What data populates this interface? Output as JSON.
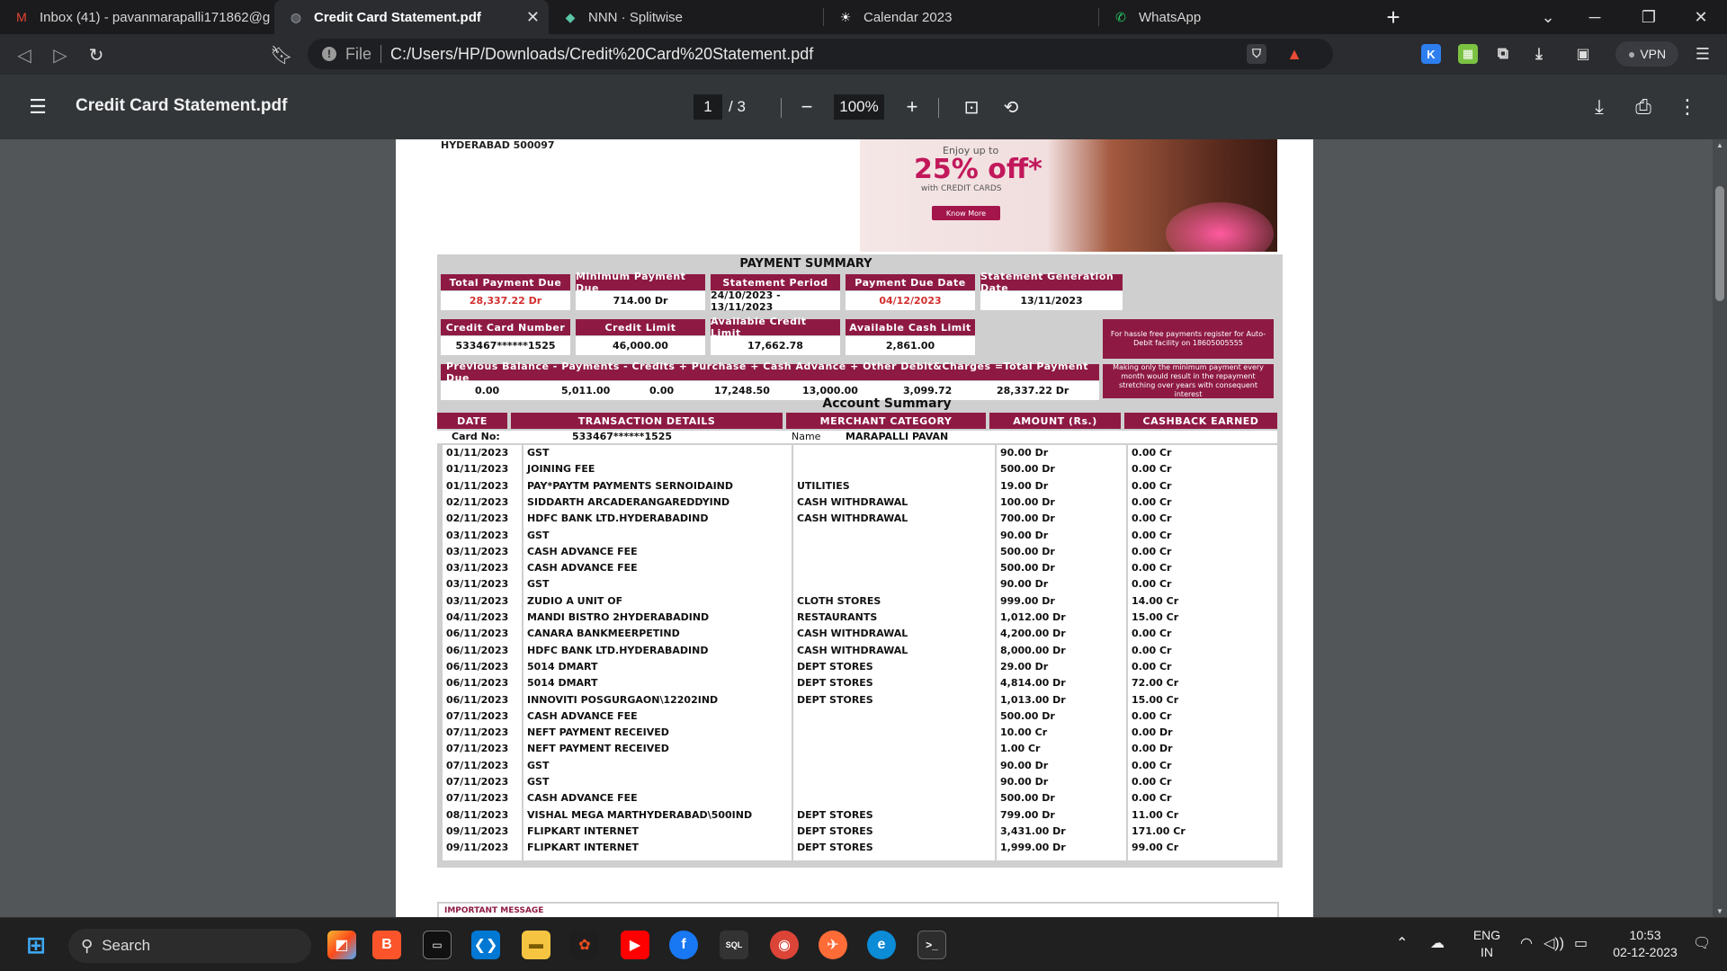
{
  "browser": {
    "tabs": [
      {
        "title": "Inbox (41) - pavanmarapalli171862@g",
        "icon": "gmail-icon",
        "color": "#ea4335",
        "glyph": "M",
        "active": false
      },
      {
        "title": "Credit Card Statement.pdf",
        "icon": "globe-icon",
        "color": "#9aa0a6",
        "glyph": "◍",
        "active": true
      },
      {
        "title": "NNN · Splitwise",
        "icon": "splitwise-icon",
        "color": "#5bc5a7",
        "glyph": "◆",
        "active": false
      },
      {
        "title": "Calendar 2023",
        "icon": "calendar-icon",
        "color": "#ffffff",
        "glyph": "☀",
        "active": false
      },
      {
        "title": "WhatsApp",
        "icon": "whatsapp-icon",
        "color": "#25d366",
        "glyph": "✆",
        "active": false
      }
    ],
    "tab_close": "✕",
    "new_tab": "+",
    "url_scheme": "File",
    "url": "C:/Users/HP/Downloads/Credit%20Card%20Statement.pdf",
    "vpn_label": "VPN"
  },
  "pdf_toolbar": {
    "title": "Credit Card Statement.pdf",
    "page_current": "1",
    "page_total": "/  3",
    "zoom": "100%"
  },
  "statement": {
    "address_line": "HYDERABAD 500097",
    "banner": {
      "line1": "Enjoy up to",
      "line2": "25% off*",
      "line3": "with CREDIT CARDS",
      "button": "Know More"
    },
    "payment_summary_title": "PAYMENT SUMMARY",
    "summary_row1": [
      {
        "label": "Total Payment Due",
        "value": "28,337.22  Dr",
        "red": true
      },
      {
        "label": "Minimum Payment Due",
        "value": "714.00   Dr",
        "red": false
      },
      {
        "label": "Statement Period",
        "value": "24/10/2023 - 13/11/2023",
        "red": false
      },
      {
        "label": "Payment Due Date",
        "value": "04/12/2023",
        "red": true
      },
      {
        "label": "Statement Generation Date",
        "value": "13/11/2023",
        "red": false
      }
    ],
    "summary_row2": [
      {
        "label": "Credit Card Number",
        "value": "533467******1525"
      },
      {
        "label": "Credit Limit",
        "value": "46,000.00"
      },
      {
        "label": "Available Credit Limit",
        "value": "17,662.78"
      },
      {
        "label": "Available Cash Limit",
        "value": "2,861.00"
      }
    ],
    "autodebit_note": "For hassle free payments register for Auto-Debit facility on 18605005555",
    "formula_header": "Previous Balance - Payments - Credits + Purchase + Cash Advance + Other Debit&Charges =Total Payment Due",
    "formula_values": [
      "0.00",
      "5,011.00",
      "0.00",
      "17,248.50",
      "13,000.00",
      "3,099.72",
      "28,337.22  Dr"
    ],
    "min_payment_note": "Making only the minimum payment every month would result in the repayment stretching over years with consequent interest",
    "account_summary_title": "Account Summary",
    "columns": [
      "DATE",
      "TRANSACTION DETAILS",
      "MERCHANT CATEGORY",
      "AMOUNT (Rs.)",
      "CASHBACK EARNED"
    ],
    "card_no_label": "Card No:",
    "card_no_value": "533467******1525",
    "name_label": "Name",
    "name_value": "MARAPALLI PAVAN",
    "transactions": [
      {
        "date": "01/11/2023",
        "details": "GST",
        "category": "",
        "amount": "90.00 Dr",
        "cashback": "0.00 Cr"
      },
      {
        "date": "01/11/2023",
        "details": "JOINING FEE",
        "category": "",
        "amount": "500.00 Dr",
        "cashback": "0.00 Cr"
      },
      {
        "date": "01/11/2023",
        "details": "PAY*PAYTM PAYMENTS SERNOIDAIND",
        "category": "UTILITIES",
        "amount": "19.00 Dr",
        "cashback": "0.00 Cr"
      },
      {
        "date": "02/11/2023",
        "details": "SIDDARTH ARCADERANGAREDDYIND",
        "category": "CASH WITHDRAWAL",
        "amount": "100.00 Dr",
        "cashback": "0.00 Cr"
      },
      {
        "date": "02/11/2023",
        "details": "HDFC BANK LTD.HYDERABADIND",
        "category": "CASH WITHDRAWAL",
        "amount": "700.00 Dr",
        "cashback": "0.00 Cr"
      },
      {
        "date": "03/11/2023",
        "details": "GST",
        "category": "",
        "amount": "90.00 Dr",
        "cashback": "0.00 Cr"
      },
      {
        "date": "03/11/2023",
        "details": "CASH ADVANCE FEE",
        "category": "",
        "amount": "500.00 Dr",
        "cashback": "0.00 Cr"
      },
      {
        "date": "03/11/2023",
        "details": "CASH ADVANCE FEE",
        "category": "",
        "amount": "500.00 Dr",
        "cashback": "0.00 Cr"
      },
      {
        "date": "03/11/2023",
        "details": "GST",
        "category": "",
        "amount": "90.00 Dr",
        "cashback": "0.00 Cr"
      },
      {
        "date": "03/11/2023",
        "details": "ZUDIO A UNIT OF",
        "category": "CLOTH STORES",
        "amount": "999.00 Dr",
        "cashback": "14.00 Cr"
      },
      {
        "date": "04/11/2023",
        "details": "MANDI BISTRO 2HYDERABADIND",
        "category": "RESTAURANTS",
        "amount": "1,012.00 Dr",
        "cashback": "15.00 Cr"
      },
      {
        "date": "06/11/2023",
        "details": "CANARA BANKMEERPETIND",
        "category": "CASH WITHDRAWAL",
        "amount": "4,200.00 Dr",
        "cashback": "0.00 Cr"
      },
      {
        "date": "06/11/2023",
        "details": "HDFC BANK LTD.HYDERABADIND",
        "category": "CASH WITHDRAWAL",
        "amount": "8,000.00 Dr",
        "cashback": "0.00 Cr"
      },
      {
        "date": "06/11/2023",
        "details": "5014 DMART",
        "category": "DEPT STORES",
        "amount": "29.00 Dr",
        "cashback": "0.00 Cr"
      },
      {
        "date": "06/11/2023",
        "details": "5014 DMART",
        "category": "DEPT STORES",
        "amount": "4,814.00 Dr",
        "cashback": "72.00 Cr"
      },
      {
        "date": "06/11/2023",
        "details": "INNOVITI POSGURGAON\\12202IND",
        "category": "DEPT STORES",
        "amount": "1,013.00 Dr",
        "cashback": "15.00 Cr"
      },
      {
        "date": "07/11/2023",
        "details": "CASH ADVANCE FEE",
        "category": "",
        "amount": "500.00 Dr",
        "cashback": "0.00 Cr"
      },
      {
        "date": "07/11/2023",
        "details": "NEFT PAYMENT RECEIVED",
        "category": "",
        "amount": "10.00 Cr",
        "cashback": "0.00 Dr"
      },
      {
        "date": "07/11/2023",
        "details": "NEFT PAYMENT RECEIVED",
        "category": "",
        "amount": "1.00 Cr",
        "cashback": "0.00 Dr"
      },
      {
        "date": "07/11/2023",
        "details": "GST",
        "category": "",
        "amount": "90.00 Dr",
        "cashback": "0.00 Cr"
      },
      {
        "date": "07/11/2023",
        "details": "GST",
        "category": "",
        "amount": "90.00 Dr",
        "cashback": "0.00 Cr"
      },
      {
        "date": "07/11/2023",
        "details": "CASH ADVANCE FEE",
        "category": "",
        "amount": "500.00 Dr",
        "cashback": "0.00 Cr"
      },
      {
        "date": "08/11/2023",
        "details": "VISHAL MEGA MARTHYDERABAD\\500IND",
        "category": "DEPT STORES",
        "amount": "799.00 Dr",
        "cashback": "11.00 Cr"
      },
      {
        "date": "09/11/2023",
        "details": "FLIPKART INTERNET",
        "category": "DEPT STORES",
        "amount": "3,431.00 Dr",
        "cashback": "171.00 Cr"
      },
      {
        "date": "09/11/2023",
        "details": "FLIPKART INTERNET",
        "category": "DEPT STORES",
        "amount": "1,999.00 Dr",
        "cashback": "99.00 Cr"
      }
    ],
    "important_message": "IMPORTANT MESSAGE"
  },
  "taskbar": {
    "search_label": "Search",
    "lang1": "ENG",
    "lang2": "IN",
    "time": "10:53",
    "date": "02-12-2023"
  },
  "colors": {
    "accent": "#8e1a44",
    "highlight_red": "#d32f2f",
    "panel_grey": "#cfcfcf"
  }
}
